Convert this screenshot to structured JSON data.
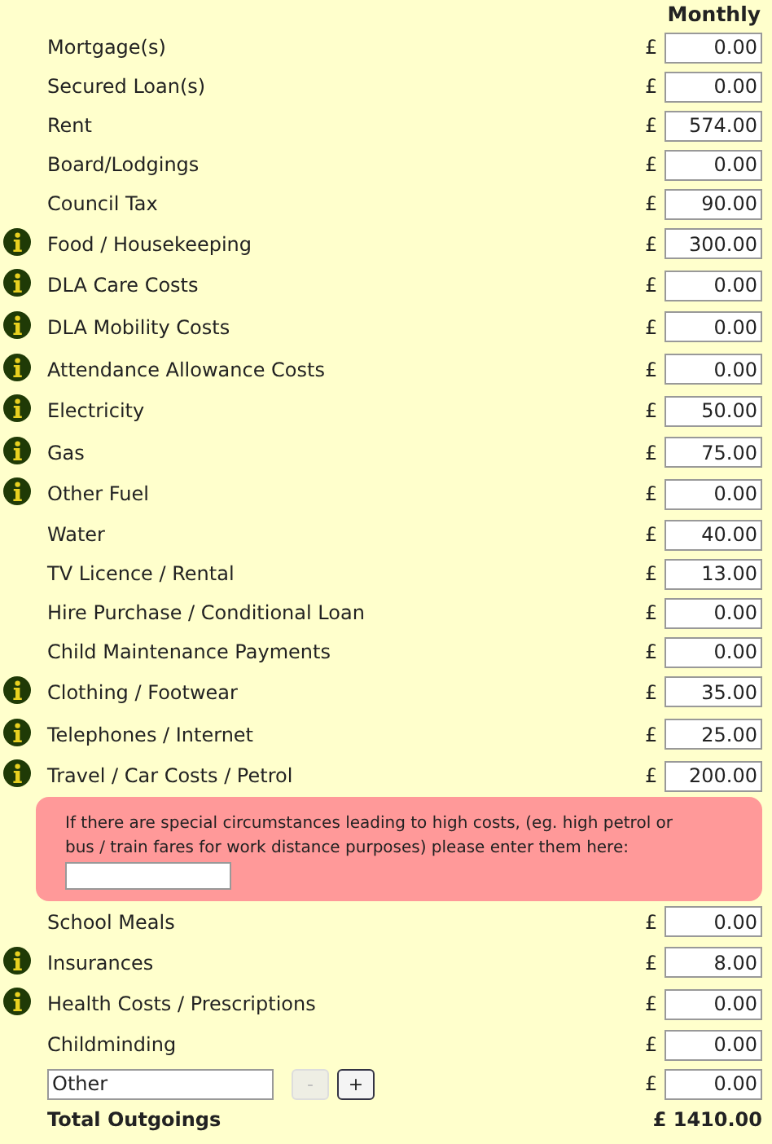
{
  "column_heading": "Monthly",
  "rows": [
    {
      "label": "Mortgage(s)",
      "info": false,
      "currency": "£",
      "value": "0.00"
    },
    {
      "label": "Secured Loan(s)",
      "info": false,
      "currency": "£",
      "value": "0.00"
    },
    {
      "label": "Rent",
      "info": false,
      "currency": "£",
      "value": "574.00"
    },
    {
      "label": "Board/Lodgings",
      "info": false,
      "currency": "£",
      "value": "0.00"
    },
    {
      "label": "Council Tax",
      "info": false,
      "currency": "£",
      "value": "90.00"
    },
    {
      "label": "Food / Housekeeping",
      "info": true,
      "currency": "£",
      "value": "300.00"
    },
    {
      "label": "DLA Care Costs",
      "info": true,
      "currency": "£",
      "value": "0.00"
    },
    {
      "label": "DLA Mobility Costs",
      "info": true,
      "currency": "£",
      "value": "0.00"
    },
    {
      "label": "Attendance Allowance Costs",
      "info": true,
      "currency": "£",
      "value": "0.00"
    },
    {
      "label": "Electricity",
      "info": true,
      "currency": "£",
      "value": "50.00"
    },
    {
      "label": "Gas",
      "info": true,
      "currency": "£",
      "value": "75.00"
    },
    {
      "label": "Other Fuel",
      "info": true,
      "currency": "£",
      "value": "0.00"
    },
    {
      "label": "Water",
      "info": false,
      "currency": "£",
      "value": "40.00"
    },
    {
      "label": "TV Licence / Rental",
      "info": false,
      "currency": "£",
      "value": "13.00"
    },
    {
      "label": "Hire Purchase / Conditional Loan",
      "info": false,
      "currency": "£",
      "value": "0.00"
    },
    {
      "label": "Child Maintenance Payments",
      "info": false,
      "currency": "£",
      "value": "0.00"
    },
    {
      "label": "Clothing / Footwear",
      "info": true,
      "currency": "£",
      "value": "35.00"
    },
    {
      "label": "Telephones / Internet",
      "info": true,
      "currency": "£",
      "value": "25.00"
    },
    {
      "label": "Travel / Car Costs / Petrol",
      "info": true,
      "currency": "£",
      "value": "200.00"
    }
  ],
  "special_circumstances": {
    "text": "If there are special circumstances leading to high costs, (eg. high petrol or bus / train fares for work distance purposes) please enter them here:"
  },
  "rows_2": [
    {
      "label": "School Meals",
      "info": false,
      "currency": "£",
      "value": "0.00"
    },
    {
      "label": "Insurances",
      "info": true,
      "currency": "£",
      "value": "8.00"
    },
    {
      "label": "Health Costs / Prescriptions",
      "info": true,
      "currency": "£",
      "value": "0.00"
    },
    {
      "label": "Childminding",
      "info": false,
      "currency": "£",
      "value": "0.00"
    }
  ],
  "other_row": {
    "name_value": "Other",
    "remove_button": {
      "label": "-",
      "disabled": true
    },
    "add_button": {
      "label": "+",
      "disabled": false
    },
    "currency": "£",
    "value": "0.00"
  },
  "total": {
    "label": "Total Outgoings",
    "amount": "£ 1410.00"
  }
}
